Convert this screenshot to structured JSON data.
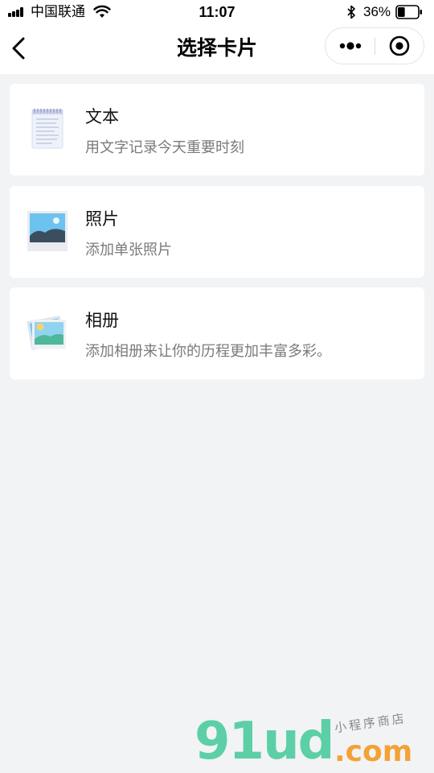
{
  "status_bar": {
    "carrier": "中国联通",
    "time": "11:07",
    "battery_percent": "36%",
    "battery_level": 0.36,
    "icons": [
      "signal-icon",
      "wifi-icon",
      "bluetooth-icon",
      "battery-icon"
    ]
  },
  "nav": {
    "title": "选择卡片",
    "back_icon": "chevron-left-icon",
    "more_icon": "more-dots-icon",
    "close_icon": "target-close-icon"
  },
  "cards": [
    {
      "title": "文本",
      "description": "用文字记录今天重要时刻",
      "icon": "notepad-icon"
    },
    {
      "title": "照片",
      "description": "添加单张照片",
      "icon": "photo-icon"
    },
    {
      "title": "相册",
      "description": "添加相册来让你的历程更加丰富多彩。",
      "icon": "album-icon"
    }
  ],
  "watermark": {
    "logo": "91ud",
    "domain": ".com",
    "tagline": "小程序商店"
  },
  "colors": {
    "background": "#f2f3f5",
    "card": "#ffffff",
    "title_text": "#111111",
    "secondary_text": "#7a7a7a",
    "watermark_green": "#5ccfa6",
    "watermark_orange": "#f3a236"
  }
}
